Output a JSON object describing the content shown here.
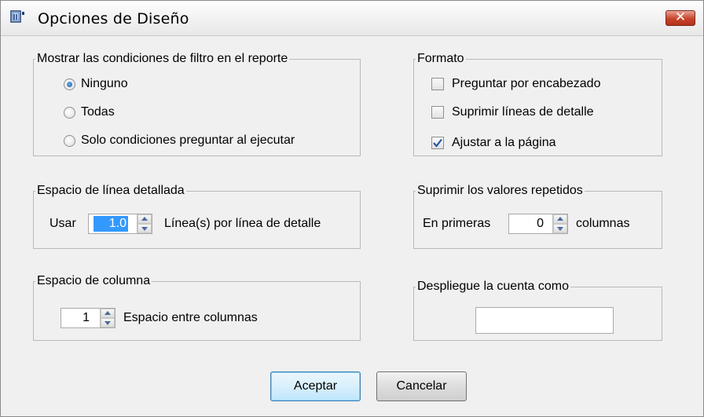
{
  "window": {
    "title": "Opciones de Diseño",
    "close_label": "✕",
    "app_icon": "report-window-icon",
    "close_icon": "close-icon"
  },
  "filter_group": {
    "label": "Mostrar las condiciones de filtro en el reporte",
    "options": [
      {
        "label": "Ninguno",
        "selected": true
      },
      {
        "label": "Todas",
        "selected": false
      },
      {
        "label": "Solo condiciones preguntar al ejecutar",
        "selected": false
      }
    ]
  },
  "format_group": {
    "label": "Formato",
    "options": [
      {
        "label": "Preguntar por encabezado",
        "checked": false
      },
      {
        "label": "Suprimir líneas de detalle",
        "checked": false
      },
      {
        "label": "Ajustar a la página",
        "checked": true
      }
    ]
  },
  "line_spacing_group": {
    "label": "Espacio de línea detallada",
    "prefix": "Usar",
    "value": "1.0",
    "suffix": "Línea(s) por línea de detalle"
  },
  "suppress_group": {
    "label": "Suprimir los valores repetidos",
    "prefix": "En primeras",
    "value": "0",
    "suffix": "columnas"
  },
  "column_spacing_group": {
    "label": "Espacio de columna",
    "value": "1",
    "suffix": "Espacio entre columnas"
  },
  "count_group": {
    "label": "Despliegue la cuenta como",
    "value": ""
  },
  "buttons": {
    "ok": "Aceptar",
    "cancel": "Cancelar"
  },
  "colors": {
    "window_bg": "#f0f0f0",
    "selection": "#3399ff",
    "close_button": "#c8432b",
    "default_button": "#bee6fd"
  }
}
